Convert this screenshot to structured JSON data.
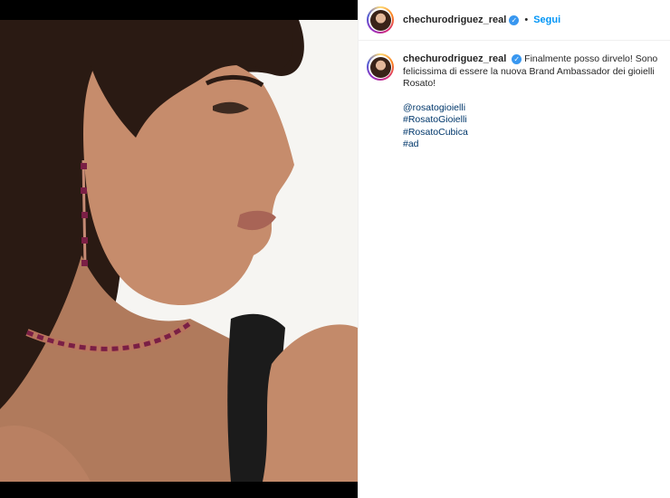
{
  "post": {
    "author": {
      "username": "chechurodriguez_real",
      "verified": true,
      "follow_label": "Segui",
      "separator": "•"
    },
    "caption": {
      "username": "chechurodriguez_real",
      "text": "Finalmente posso dirvelo! Sono felicissima di essere la nuova Brand Ambassador dei gioielli Rosato!",
      "tags": [
        "@rosatogioielli",
        "#RosatoGioielli",
        "#RosatoCubica",
        "#ad"
      ]
    },
    "colors": {
      "link": "#00376b",
      "follow": "#0095f6",
      "verified": "#3897f0",
      "letterbox": "#000000"
    },
    "icons": {
      "verified": "verified-badge-icon"
    }
  }
}
